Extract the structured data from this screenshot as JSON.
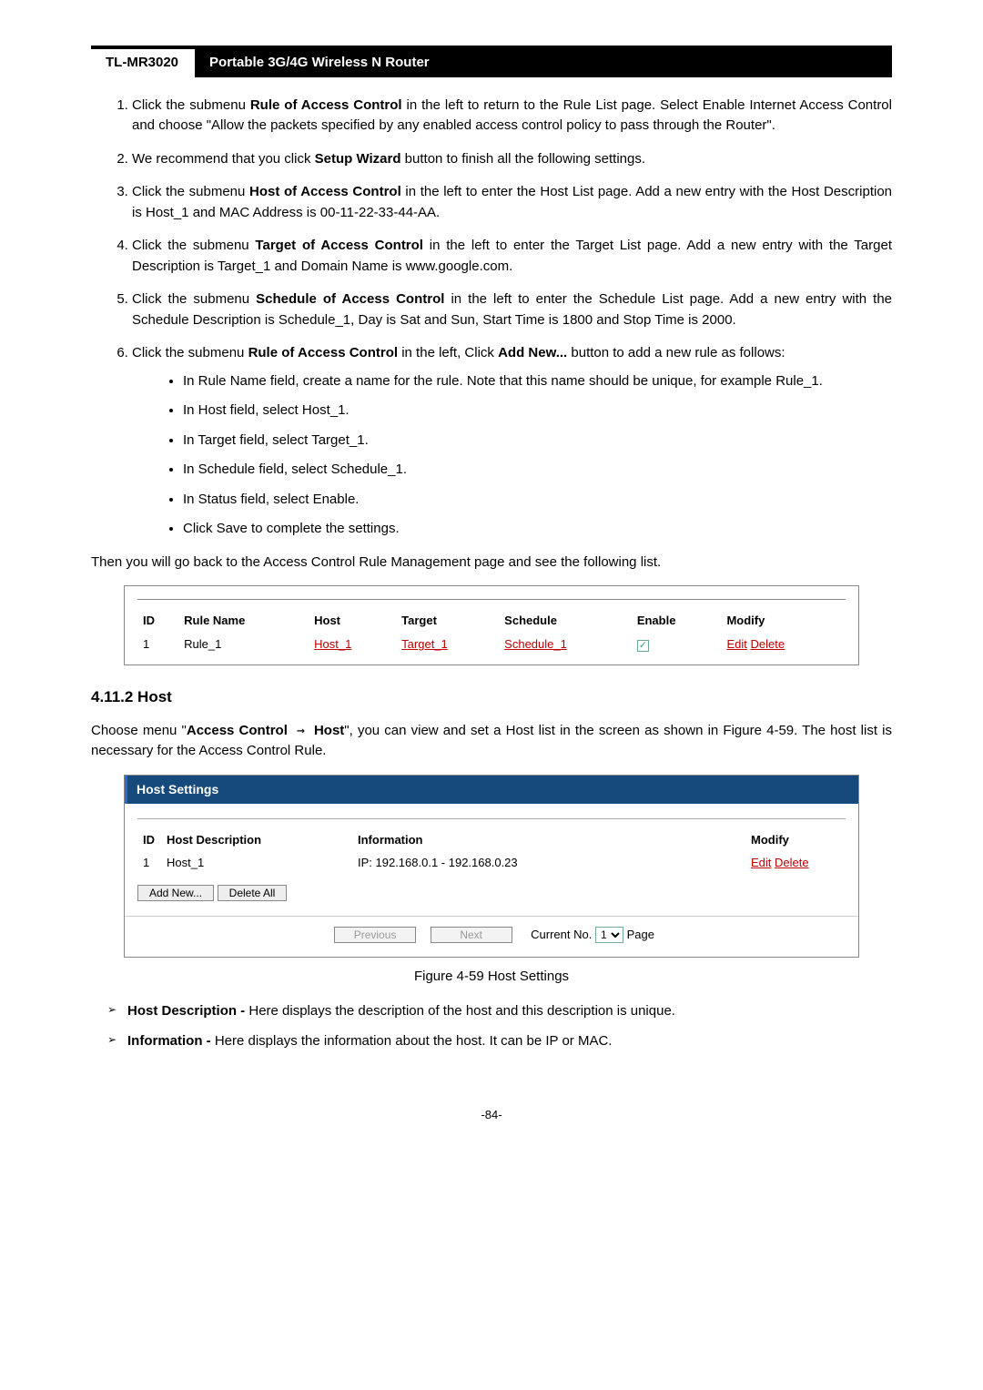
{
  "header": {
    "model": "TL-MR3020",
    "title": "Portable 3G/4G Wireless N Router"
  },
  "steps": {
    "s1_a": "Click the submenu ",
    "s1_b": "Rule of Access Control",
    "s1_c": " in the left to return to the Rule List page. Select Enable Internet Access Control and choose \"Allow the packets specified by any enabled access control policy to pass through the Router\".",
    "s2_a": "We recommend that you click ",
    "s2_b": "Setup Wizard",
    "s2_c": " button to finish all the following settings.",
    "s3_a": "Click the submenu ",
    "s3_b": "Host of Access Control",
    "s3_c": " in the left to enter the Host List page. Add a new entry with the Host Description is Host_1 and MAC Address is 00-11-22-33-44-AA.",
    "s4_a": "Click the submenu ",
    "s4_b": "Target of Access Control",
    "s4_c": " in the left to enter the Target List page. Add a new entry with the Target Description is Target_1 and Domain Name is www.google.com.",
    "s5_a": "Click the submenu ",
    "s5_b": "Schedule of Access Control",
    "s5_c": " in the left to enter the Schedule List page. Add a new entry with the Schedule Description is Schedule_1, Day is Sat and Sun, Start Time is 1800 and Stop Time is 2000.",
    "s6_a": "Click the submenu ",
    "s6_b": "Rule of Access Control",
    "s6_c": " in the left, Click ",
    "s6_d": "Add New...",
    "s6_e": " button to add a new rule as follows:"
  },
  "substeps": {
    "b1": "In Rule Name field, create a name for the rule. Note that this name should be unique, for example Rule_1.",
    "b2": "In Host field, select Host_1.",
    "b3": "In Target field, select Target_1.",
    "b4": "In Schedule field, select Schedule_1.",
    "b5": "In Status field, select Enable.",
    "b6": "Click Save to complete the settings."
  },
  "afterList": "Then you will go back to the Access Control Rule Management page and see the following list.",
  "ruleTable": {
    "headers": {
      "id": "ID",
      "rule": "Rule Name",
      "host": "Host",
      "target": "Target",
      "schedule": "Schedule",
      "enable": "Enable",
      "modify": "Modify"
    },
    "row": {
      "id": "1",
      "rule": "Rule_1",
      "host": "Host_1",
      "target": "Target_1",
      "schedule": "Schedule_1",
      "check": "✓",
      "edit": "Edit",
      "delete": "Delete"
    }
  },
  "section": {
    "num_title": "4.11.2  Host"
  },
  "hostIntro": {
    "a": "Choose menu \"",
    "b": "Access Control",
    "c": "Host",
    "d": "\", you can view and set a Host list in the screen as shown in Figure 4-59. The host list is necessary for the Access Control Rule.",
    "arrow": " → "
  },
  "hostPanel": {
    "title": "Host Settings",
    "headers": {
      "id": "ID",
      "desc": "Host Description",
      "info": "Information",
      "modify": "Modify"
    },
    "row": {
      "id": "1",
      "desc": "Host_1",
      "info": "IP: 192.168.0.1 - 192.168.0.23",
      "edit": "Edit",
      "delete": "Delete"
    },
    "buttons": {
      "addnew": "Add New...",
      "deleteall": "Delete All",
      "previous": "Previous",
      "next": "Next"
    },
    "pager": {
      "label_a": "Current No.",
      "page_value": "1",
      "label_b": "Page"
    }
  },
  "figCaption": "Figure 4-59    Host Settings",
  "bullets": {
    "hd_t": "Host Description - ",
    "hd_b": "Here displays the description of the host and this description is unique.",
    "inf_t": "Information - ",
    "inf_b": "Here displays the information about the host. It can be IP or MAC."
  },
  "pageNum": "-84-"
}
